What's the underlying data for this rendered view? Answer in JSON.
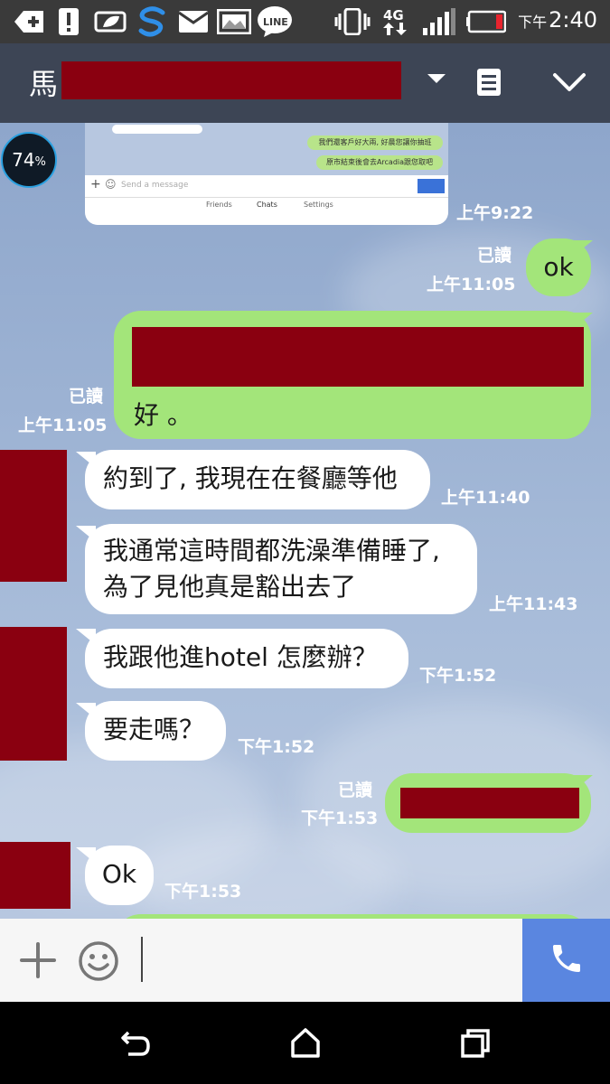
{
  "statusbar": {
    "network": "4G",
    "clock_ampm": "下午",
    "clock_time": "2:40",
    "line_badge": "LINE",
    "icons": [
      "add-square-icon",
      "alert-icon",
      "leaf-icon",
      "s-app-icon",
      "mail-icon",
      "image-icon",
      "line-app-icon",
      "vibrate-icon",
      "network-4g-icon",
      "signal-icon",
      "battery-low-icon"
    ]
  },
  "header": {
    "contact_initial": "馬",
    "icons": [
      "dropdown-arrow-icon",
      "notes-icon",
      "chevron-down-icon"
    ]
  },
  "overlay": {
    "progress_percent": "74",
    "percent_sign": "%"
  },
  "screenshot_preview": {
    "line1": "我們還客戶好大兩, 好晨您讓你抽班",
    "line2": "原市結束後會去Arcadia跟您取吧",
    "placeholder": "Send a message",
    "tabs": [
      "Friends",
      "Chats",
      "Settings"
    ]
  },
  "messages": [
    {
      "id": "m0",
      "dir": "in",
      "type": "image",
      "time": "上午9:22"
    },
    {
      "id": "m1",
      "dir": "out",
      "text": "ok",
      "read": "已讀",
      "time": "上午11:05"
    },
    {
      "id": "m2",
      "dir": "out",
      "text": "好 。",
      "read": "已讀",
      "time": "上午11:05"
    },
    {
      "id": "m3",
      "dir": "in",
      "text": "約到了, 我現在在餐廳等他",
      "time": "上午11:40"
    },
    {
      "id": "m4",
      "dir": "in",
      "lines": [
        "我通常這時間都洗澡準備睡了,",
        "為了見他真是豁出去了"
      ],
      "time": "上午11:43"
    },
    {
      "id": "m5",
      "dir": "in",
      "text": "我跟他進hotel 怎麼辦？",
      "time": "下午1:52"
    },
    {
      "id": "m6",
      "dir": "in",
      "text": "要走嗎？",
      "time": "下午1:52"
    },
    {
      "id": "m7",
      "dir": "out",
      "text": "",
      "read": "已讀",
      "time": "下午1:53"
    },
    {
      "id": "m8",
      "dir": "in",
      "text": "Ok",
      "time": "下午1:53"
    }
  ],
  "inputbar": {
    "icons": [
      "plus-icon",
      "emoji-icon",
      "phone-icon"
    ]
  },
  "navbar": {
    "icons": [
      "back-icon",
      "home-icon",
      "recents-icon"
    ]
  },
  "colors": {
    "incoming": "#ffffff",
    "outgoing": "#a3e57a",
    "header": "#3d4555",
    "call": "#5a86e0",
    "redaction": "#8a0010"
  }
}
